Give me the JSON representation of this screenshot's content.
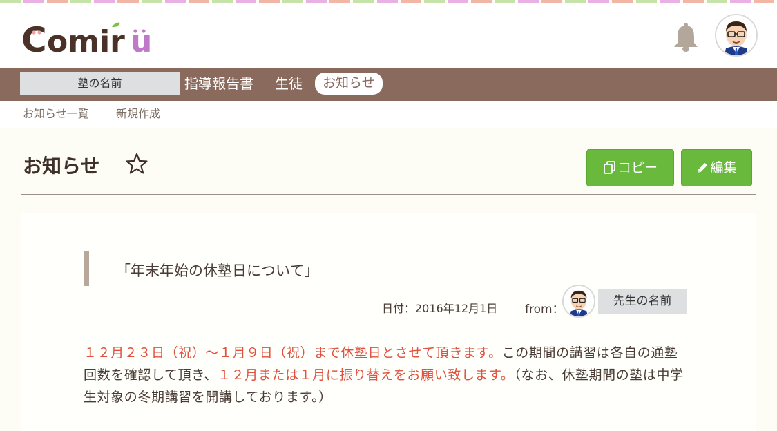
{
  "colors": {
    "stripe": [
      "#c6e3a9",
      "#e9b1e3",
      "#f2b6a6",
      "#c6e3a9",
      "#e9b1e3",
      "#f2b6a6"
    ],
    "nav_bg": "#8a6a5c",
    "accent_green": "#69b93c",
    "highlight_red": "#e0523f"
  },
  "header": {
    "logo_text": "Comiru",
    "bell_icon": "bell-icon",
    "avatar_icon": "teacher-avatar"
  },
  "nav": {
    "school_name": "塾の名前",
    "items": [
      {
        "label": "指導報告書"
      },
      {
        "label": "生徒"
      },
      {
        "label": "お知らせ"
      }
    ]
  },
  "subnav": {
    "items": [
      {
        "label": "お知らせ一覧"
      },
      {
        "label": "新規作成"
      }
    ]
  },
  "page": {
    "title": "お知らせ",
    "star_icon": "star-outline-icon",
    "copy_label": "コピー",
    "edit_label": "編集"
  },
  "notice": {
    "title": "「年末年始の休塾日について」",
    "date_text": "日付：2016年12月1日",
    "from_label": "from：",
    "teacher_name": "先生の名前",
    "body_segments": [
      {
        "text": "１２月２３日（祝）〜１月９日（祝）まで休塾日とさせて頂きます。",
        "highlight": true
      },
      {
        "text": "この期間の講習は各自の通塾回数を確認して頂き、",
        "highlight": false
      },
      {
        "text": "１２月または１月に振り替えをお願い致します。",
        "highlight": true
      },
      {
        "text": "（なお、休塾期間の塾は中学生対象の冬期講習を開講しております。）",
        "highlight": false
      }
    ]
  }
}
